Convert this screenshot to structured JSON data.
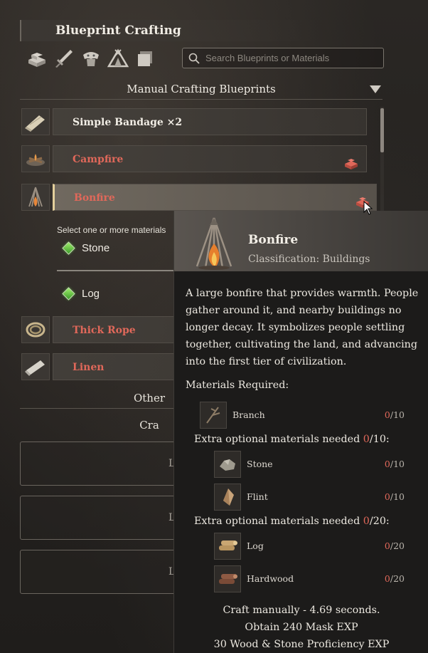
{
  "panel": {
    "title": "Blueprint Crafting"
  },
  "categories": [
    {
      "icon": "materials-stack-icon"
    },
    {
      "icon": "sword-icon"
    },
    {
      "icon": "armor-icon"
    },
    {
      "icon": "tent-icon"
    },
    {
      "icon": "furniture-icon"
    }
  ],
  "search": {
    "placeholder": "Search Blueprints or Materials",
    "value": ""
  },
  "section": {
    "title": "Manual Crafting Blueprints"
  },
  "blueprints": [
    {
      "label": "Simple Bandage ×2",
      "color": "#f2eee6"
    },
    {
      "label": "Campfire",
      "color": "#e0685a"
    },
    {
      "label": "Bonfire",
      "color": "#e0685a",
      "selected": true
    },
    {
      "label": "Thick Rope",
      "color": "#e0685a"
    },
    {
      "label": "Linen",
      "color": "#e0685a"
    }
  ],
  "selection": {
    "note": "Select one or more materials",
    "options": [
      "Stone",
      "Log"
    ]
  },
  "other_section": {
    "title": "Other Cra"
  },
  "slots": [
    {
      "label": "L"
    },
    {
      "label": "L"
    },
    {
      "label": "L"
    }
  ],
  "tooltip": {
    "name": "Bonfire",
    "classification": "Classification: Buildings",
    "description": "A large bonfire that provides warmth. People gather around it, and nearby buildings no longer decay. It symbolizes people settling together, cultivating the land, and advancing into the first tier of civilization.",
    "materials_label": "Materials Required:",
    "required": [
      {
        "name": "Branch",
        "have": "0",
        "need": "/10"
      }
    ],
    "extra1": {
      "prefix": "Extra optional materials needed ",
      "have": "0",
      "suffix": "/10:"
    },
    "extra1_items": [
      {
        "name": "Stone",
        "have": "0",
        "need": "/10"
      },
      {
        "name": "Flint",
        "have": "0",
        "need": "/10"
      }
    ],
    "extra2": {
      "prefix": "Extra optional materials needed ",
      "have": "0",
      "suffix": "/20:"
    },
    "extra2_items": [
      {
        "name": "Log",
        "have": "0",
        "need": "/20"
      },
      {
        "name": "Hardwood",
        "have": "0",
        "need": "/20"
      }
    ],
    "footer": [
      "Craft manually - 4.69 seconds.",
      "Obtain 240 Mask EXP",
      "30 Wood & Stone Proficiency EXP"
    ]
  },
  "colors": {
    "accent_red": "#e0685a",
    "selected_bar": "#e3cf9b",
    "option_green": "#6fd04a"
  }
}
